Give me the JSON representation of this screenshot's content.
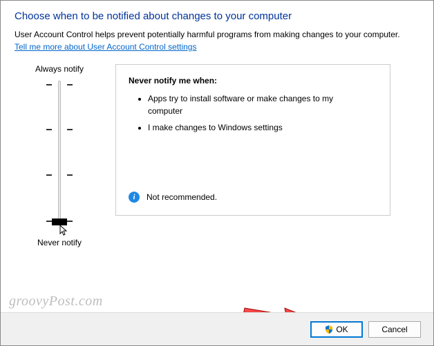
{
  "title": "Choose when to be notified about changes to your computer",
  "description": "User Account Control helps prevent potentially harmful programs from making changes to your computer.",
  "link_text": "Tell me more about User Account Control settings",
  "slider": {
    "top_label": "Always notify",
    "bottom_label": "Never notify"
  },
  "panel": {
    "heading": "Never notify me when:",
    "items": [
      "Apps try to install software or make changes to my computer",
      "I make changes to Windows settings"
    ],
    "recommendation": "Not recommended."
  },
  "buttons": {
    "ok": "OK",
    "cancel": "Cancel"
  },
  "watermark": "groovyPost.com"
}
